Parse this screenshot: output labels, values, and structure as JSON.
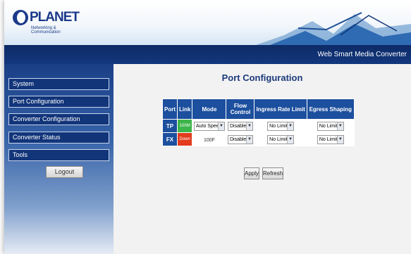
{
  "header": {
    "logo_text": "PLANET",
    "logo_subtext": "Networking & Communication",
    "product_title": "Web Smart Media Converter"
  },
  "sidebar": {
    "items": [
      {
        "label": "System"
      },
      {
        "label": "Port Configuration"
      },
      {
        "label": "Converter Configuration"
      },
      {
        "label": "Converter Status"
      },
      {
        "label": "Tools"
      }
    ],
    "logout_label": "Logout"
  },
  "main": {
    "title": "Port Configuration",
    "table": {
      "headers": {
        "port": "Port",
        "link": "Link",
        "mode": "Mode",
        "flow_control": "Flow Control",
        "ingress": "Ingress Rate Limit",
        "egress": "Egress Shaping"
      },
      "rows": [
        {
          "port": "TP",
          "link": "100M",
          "mode": "Auto Speed",
          "flow_control": "Disabled",
          "ingress": "No Limit",
          "egress": "No Limit"
        },
        {
          "port": "FX",
          "link": "Down",
          "mode": "100F",
          "flow_control": "Disabled",
          "ingress": "No Limit",
          "egress": "No Limit"
        }
      ]
    },
    "buttons": {
      "apply": "Apply",
      "refresh": "Refresh"
    }
  },
  "colors": {
    "brand_blue": "#1c3a8a",
    "table_header": "#1c4f9e",
    "link_up": "#3cb54a",
    "link_down": "#e23b1e"
  }
}
